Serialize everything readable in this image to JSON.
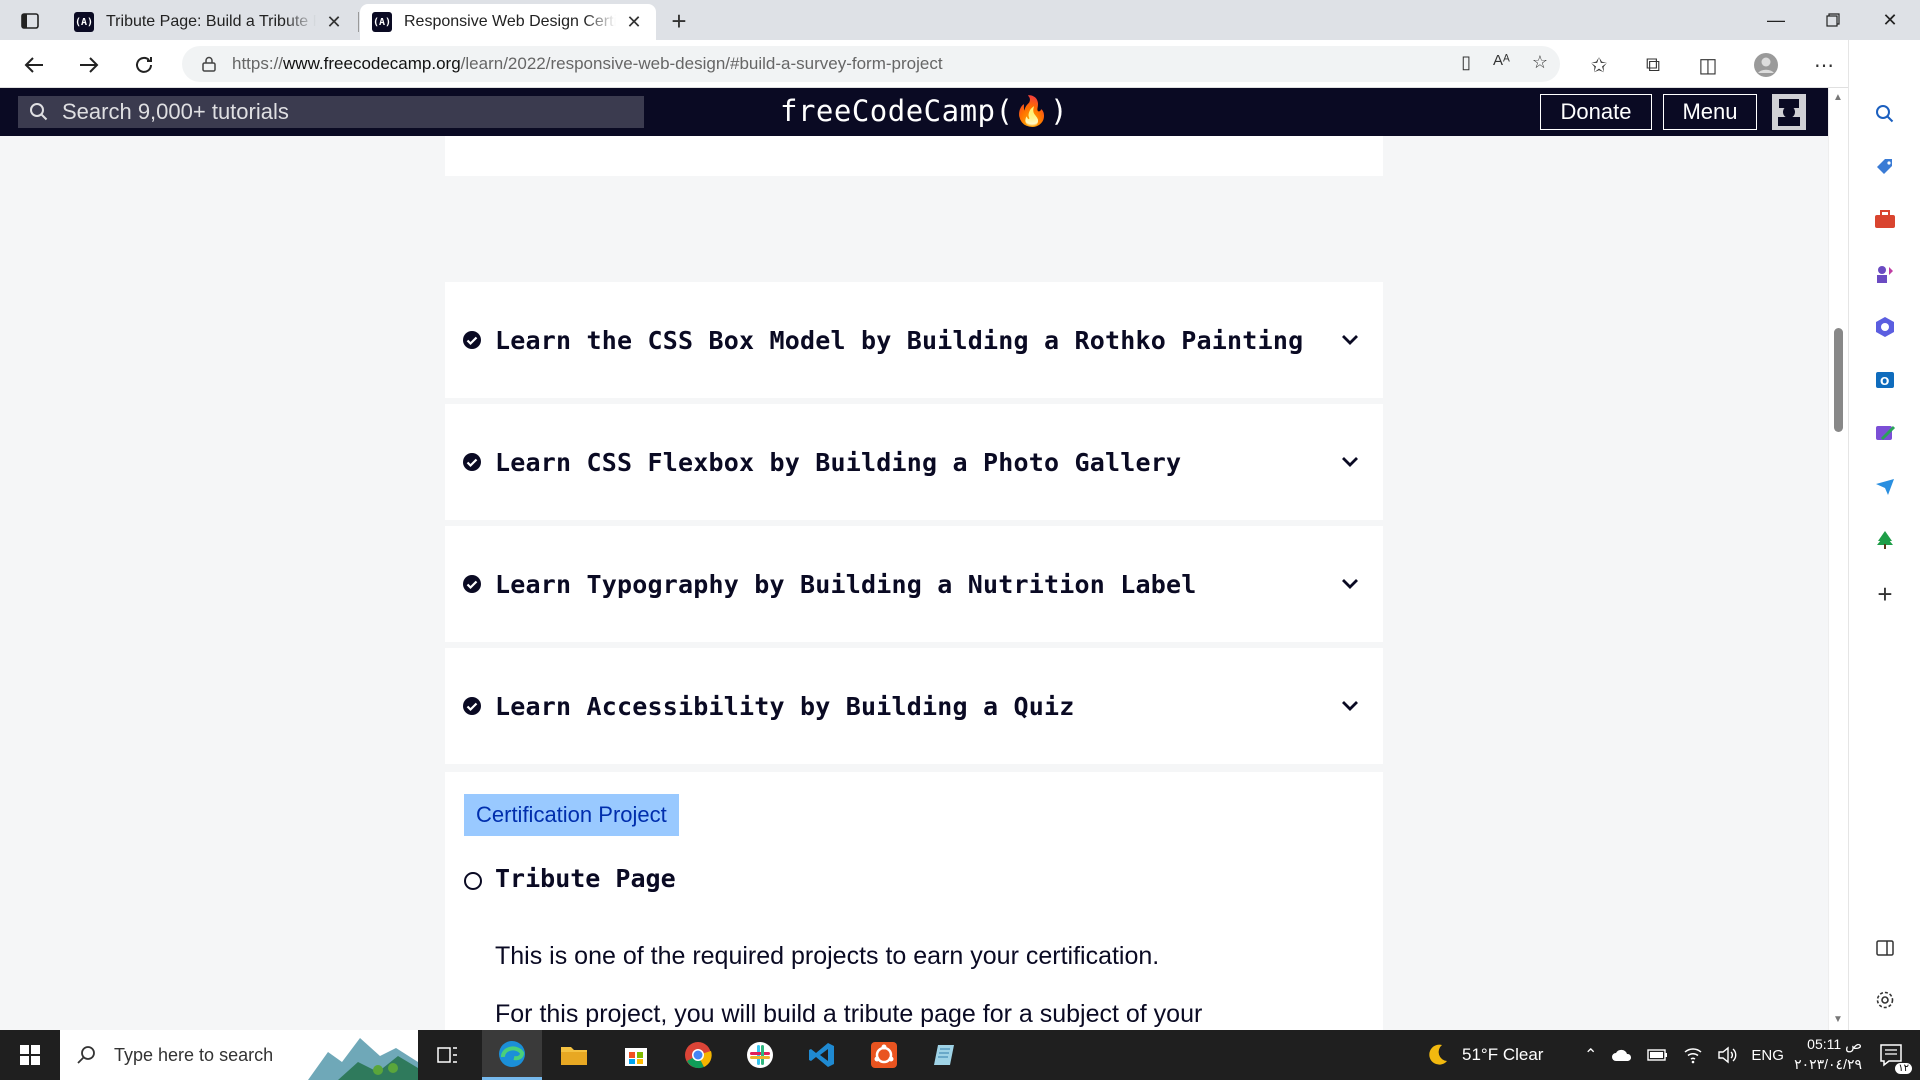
{
  "browser": {
    "tabs": [
      {
        "title": "Tribute Page: Build a Tribute Page",
        "favicon": "(A)"
      },
      {
        "title": "Responsive Web Design Certification",
        "favicon": "(A)"
      }
    ],
    "url_prefix": "https://",
    "url_host": "www.freecodecamp.org",
    "url_path": "/learn/2022/responsive-web-design/#build-a-survey-form-project"
  },
  "fcc_nav": {
    "search_placeholder": "Search 9,000+ tutorials",
    "logo": "freeCodeCamp(🔥)",
    "donate": "Donate",
    "menu": "Menu"
  },
  "blocks": [
    {
      "title": "Learn the CSS Box Model by Building a Rothko Painting",
      "completed": true
    },
    {
      "title": "Learn CSS Flexbox by Building a Photo Gallery",
      "completed": true
    },
    {
      "title": "Learn Typography by Building a Nutrition Label",
      "completed": true
    },
    {
      "title": "Learn Accessibility by Building a Quiz",
      "completed": true
    }
  ],
  "certification": {
    "badge": "Certification Project",
    "project_title": "Tribute Page",
    "desc_line1": "This is one of the required projects to earn your certification.",
    "desc_line2": "For this project, you will build a tribute page for a subject of your"
  },
  "taskbar": {
    "search_placeholder": "Type here to search",
    "weather": "51°F  Clear",
    "lang": "ENG",
    "time": "05:11 ص",
    "date": "٢٠٢٣/٠٤/٢٩",
    "notification_count": "١٢"
  },
  "colors": {
    "fcc_dark": "#0a0a23",
    "fcc_search": "#3b3b4f",
    "badge_bg": "#99c9ff",
    "badge_text": "#002ead"
  }
}
